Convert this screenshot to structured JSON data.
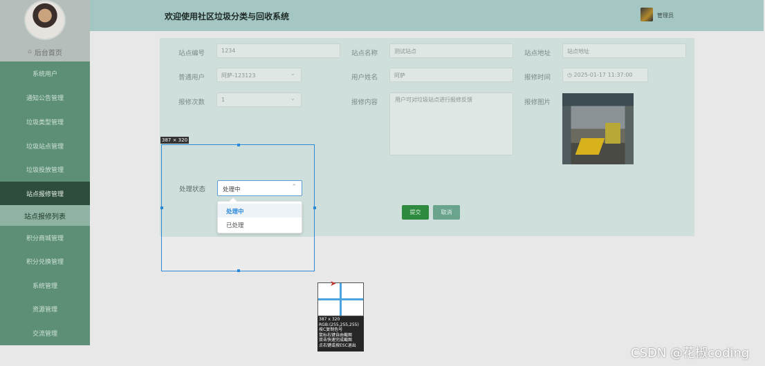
{
  "header": {
    "title": "欢迎使用社区垃圾分类与回收系统",
    "admin": "管理员"
  },
  "sidebar": {
    "home": "后台首页",
    "items": [
      {
        "label": "系统用户"
      },
      {
        "label": "通知公告管理"
      },
      {
        "label": "垃圾类型管理"
      },
      {
        "label": "垃圾站点管理"
      },
      {
        "label": "垃圾投放管理"
      },
      {
        "label": "站点报修管理"
      },
      {
        "label": "积分商城管理"
      },
      {
        "label": "积分兑换管理"
      },
      {
        "label": "系统管理"
      },
      {
        "label": "资源管理"
      },
      {
        "label": "交流管理"
      }
    ],
    "sub_item": "站点报修列表"
  },
  "form": {
    "station_no_label": "站点编号",
    "station_no": "1234",
    "station_name_label": "站点名称",
    "station_name": "测试站点",
    "station_addr_label": "站点地址",
    "station_addr": "站点地址",
    "user_label": "普通用户",
    "user": "阿萨-123123",
    "username_label": "用户姓名",
    "username": "阿萨",
    "time_label": "报修时间",
    "time": "2025-01-17 11:37:00",
    "count_label": "报修次数",
    "count": "1",
    "content_label": "报修内容",
    "content": "用户可对垃圾站点进行报修反馈",
    "image_label": "报修图片",
    "submit": "提交",
    "cancel": "取消"
  },
  "status": {
    "label": "处理状态",
    "value": "处理中",
    "options": [
      "处理中",
      "已处理"
    ]
  },
  "capture": {
    "size": "387 × 320",
    "mag_lines": [
      "387 x 320",
      "RGB:(255,255,255)",
      "按C复制色号",
      "鼠标右键自由截图",
      "双击快速完成截图",
      "点右键或按ESC退出"
    ]
  },
  "watermark": "CSDN @花椒coding"
}
